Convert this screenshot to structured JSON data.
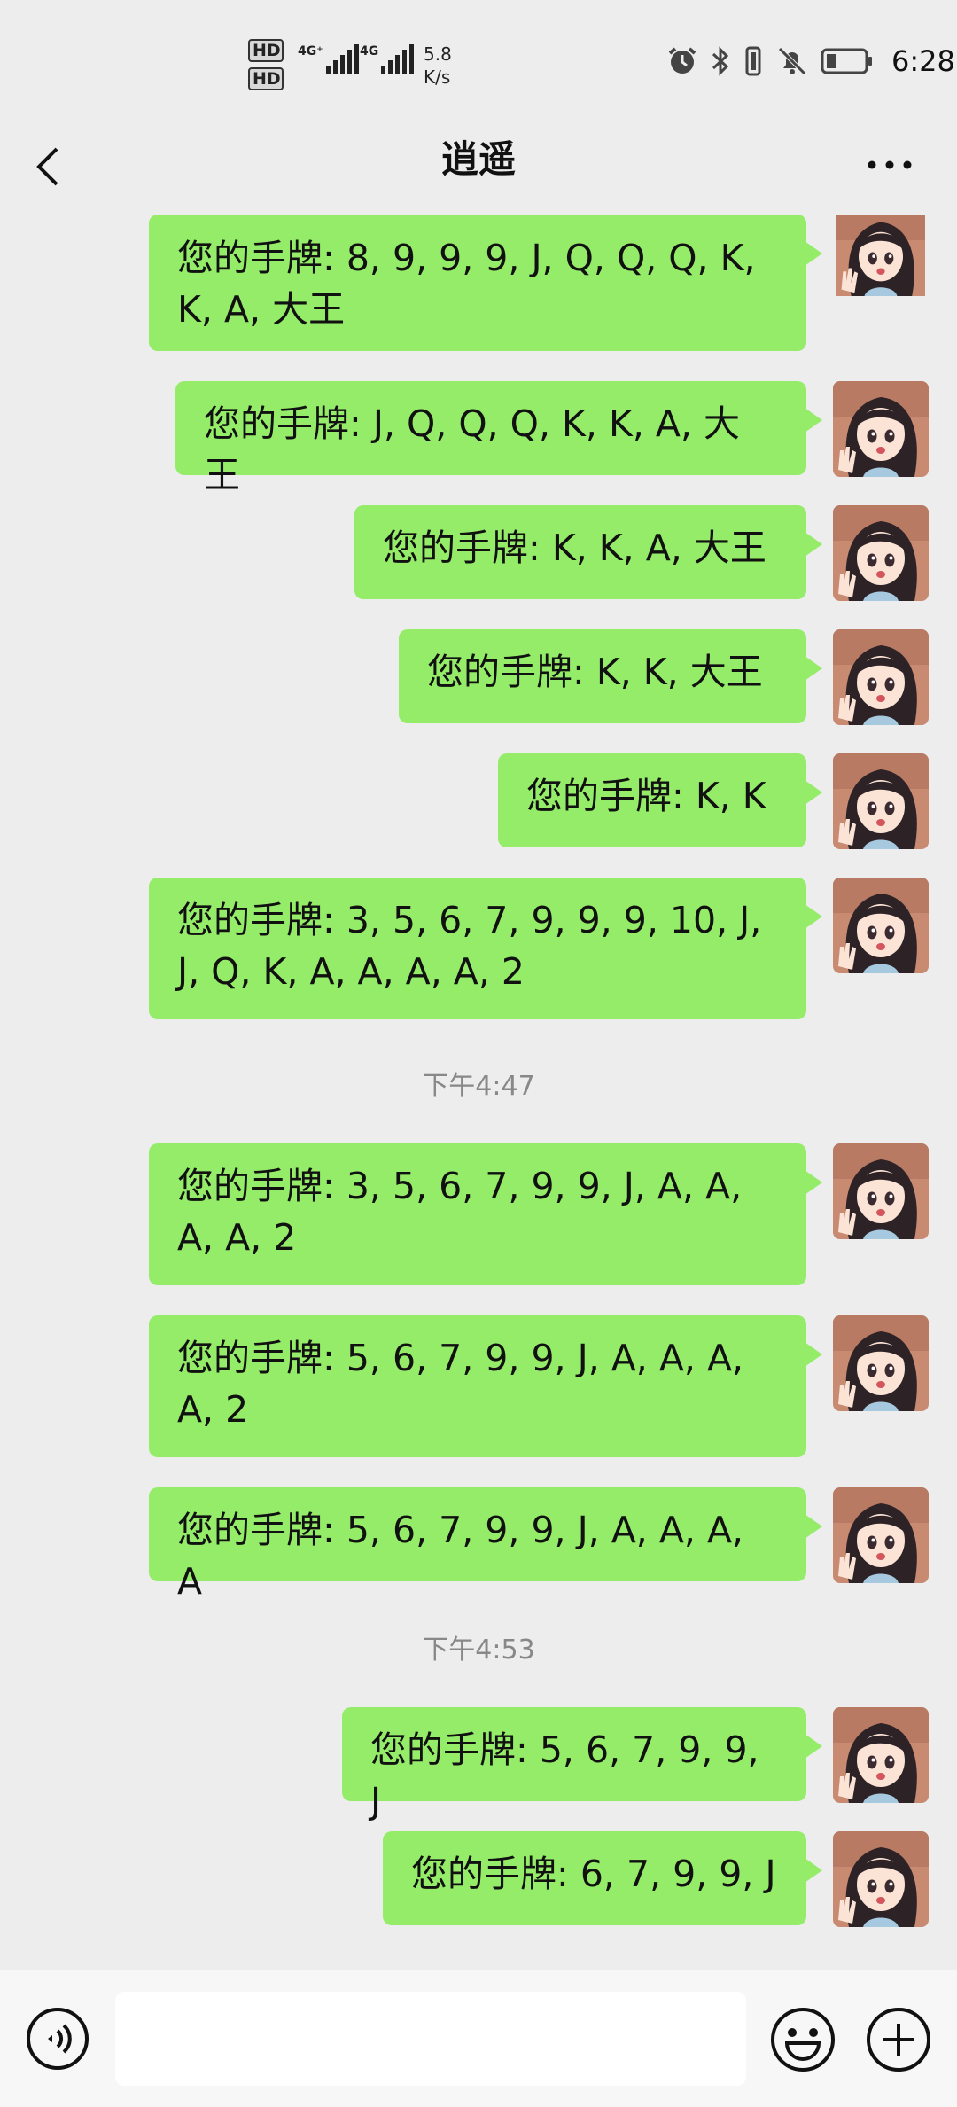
{
  "status_bar": {
    "hd1": "HD",
    "hd2": "HD",
    "net1": "4G⁺",
    "net2": "4G",
    "speed_value": "5.8",
    "speed_unit": "K/s",
    "time": "6:28",
    "icons": [
      "alarm-icon",
      "bluetooth-icon",
      "vibrate-icon",
      "mute-icon",
      "battery-icon"
    ]
  },
  "header": {
    "title": "逍遥",
    "back_icon": "chevron-left-icon",
    "more_icon": "more-icon"
  },
  "messages": [
    {
      "text": "您的手牌: 8, 9, 9, 9, J, Q, Q, Q, K, K, A, 大王"
    },
    {
      "text": "您的手牌: J, Q, Q, Q, K, K, A, 大王"
    },
    {
      "text": "您的手牌: K, K, A, 大王"
    },
    {
      "text": "您的手牌: K, K, 大王"
    },
    {
      "text": "您的手牌: K, K"
    },
    {
      "text": "您的手牌: 3, 5, 6, 7, 9, 9, 9, 10, J, J, Q, K, A, A, A, A, 2"
    },
    {
      "text": "您的手牌: 3, 5, 6, 7, 9, 9, J, A, A, A, A, 2"
    },
    {
      "text": "您的手牌: 5, 6, 7, 9, 9, J, A, A, A, A, 2"
    },
    {
      "text": "您的手牌: 5, 6, 7, 9, 9, J, A, A, A, A"
    },
    {
      "text": "您的手牌: 5, 6, 7, 9, 9, J"
    },
    {
      "text": "您的手牌: 6, 7, 9, 9, J"
    }
  ],
  "timestamps": [
    "下午4:47",
    "下午4:53"
  ],
  "input_bar": {
    "voice_icon": "voice-icon",
    "input_value": "",
    "emoji_icon": "emoji-icon",
    "plus_icon": "plus-icon"
  },
  "colors": {
    "background": "#ededed",
    "bubble": "#95ec69",
    "timestamp": "#888888",
    "input_bar": "#f7f7f7"
  }
}
